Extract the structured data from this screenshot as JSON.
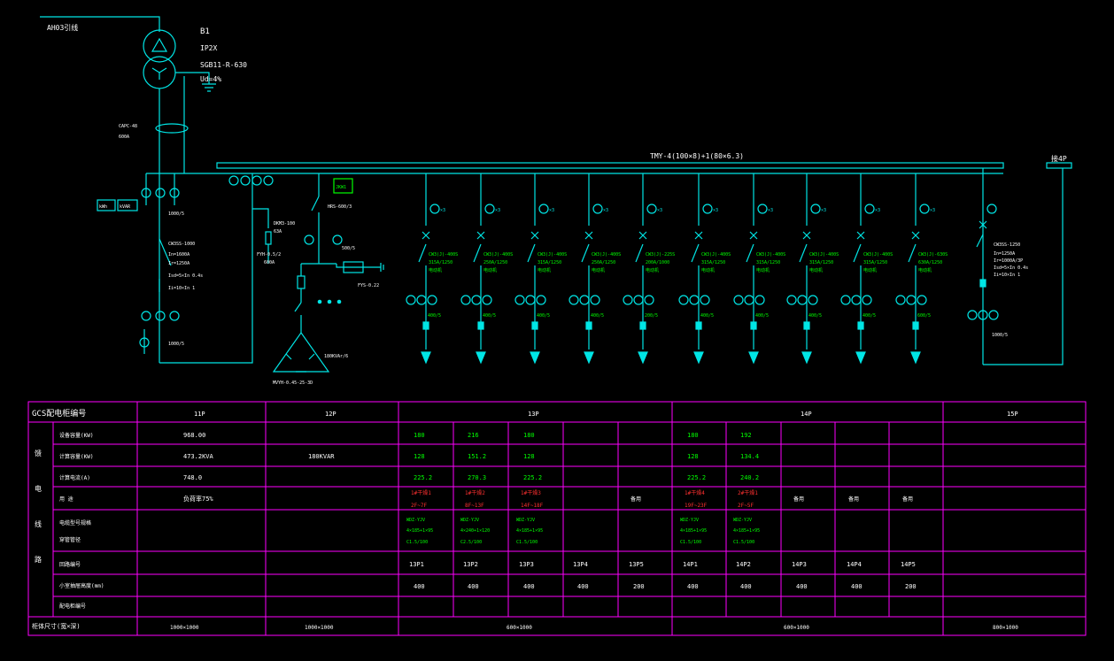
{
  "colors": {
    "background": "#000000",
    "wire": "#00e5e5",
    "grid": "#ff00ff",
    "text": "#ffffff",
    "value": "#00ff00",
    "alert": "#ff3030"
  },
  "diagram": {
    "incoming_label": "AH03引线",
    "transformer": {
      "name": "B1",
      "protection": "IP2X",
      "model": "SGB11-R-630",
      "impedance": "Ud=4%"
    },
    "busway_label": "CAPC-48",
    "busway_sub": "600A",
    "busbar_label": "TMY-4(100×8)+1(80×6.3)",
    "tie_label": "接4P",
    "meter_kwh": "kWh",
    "meter_kvar": "kVAR",
    "incomer": {
      "ct_top": "1000/5",
      "breaker": "CW3SS-1000",
      "b1": "In=1600A",
      "b2": "Ir=1250A",
      "b3": "Isd=5×In 0.4s",
      "b4": "Ii=10×In 1",
      "ct_bottom": "1000/5"
    },
    "capacitor": {
      "fuse": "DKM3-100",
      "fuse_sub": "63A",
      "arrester": "FYH-0.5/2",
      "arrester_sub": "600A",
      "switch": "HRS-600/3",
      "ct": "500/5",
      "reactor": "FYS-0.22",
      "bank": "180KVAr/6",
      "model": "MVYH-0.45-25-3D",
      "controller": "JKW1"
    },
    "tie_breaker": {
      "name": "CW3SS-1250",
      "l1": "In=1250A",
      "l2": "Ir=1000A/3P",
      "l3": "Isd=5×In 0.4s",
      "l4": "Ii=10×In 1",
      "ct": "1000/5"
    },
    "feeders": [
      {
        "amm": "×3",
        "brk": "CW3(J)-400S",
        "set": "315A/1250",
        "ctg": "400/5",
        "note": "电动机"
      },
      {
        "amm": "×3",
        "brk": "CW3(J)-400S",
        "set": "250A/1250",
        "ctg": "400/5",
        "note": "电动机"
      },
      {
        "amm": "×3",
        "brk": "CW3(J)-400S",
        "set": "315A/1250",
        "ctg": "400/5",
        "note": "电动机"
      },
      {
        "amm": "×3",
        "brk": "CW3(J)-400S",
        "set": "250A/1250",
        "ctg": "400/5",
        "note": "电动机"
      },
      {
        "amm": "×3",
        "brk": "CW3(J)-225S",
        "set": "200A/1000",
        "ctg": "200/5",
        "note": "电动机"
      },
      {
        "amm": "×3",
        "brk": "CW3(J)-400S",
        "set": "315A/1250",
        "ctg": "400/5",
        "note": "电动机"
      },
      {
        "amm": "×3",
        "brk": "CW3(J)-400S",
        "set": "315A/1250",
        "ctg": "400/5",
        "note": "电动机"
      },
      {
        "amm": "×3",
        "brk": "CW3(J)-400S",
        "set": "315A/1250",
        "ctg": "400/5",
        "note": "电动机"
      },
      {
        "amm": "×3",
        "brk": "CW3(J)-400S",
        "set": "315A/1250",
        "ctg": "400/5",
        "note": "电动机"
      },
      {
        "amm": "×3",
        "brk": "CW3(J)-630S",
        "set": "630A/1250",
        "ctg": "600/5",
        "note": "电动机"
      }
    ]
  },
  "table": {
    "header_label": "GCS配电柜编号",
    "panels": [
      "11P",
      "12P",
      "13P",
      "14P",
      "15P"
    ],
    "side_label": [
      "馈",
      "电",
      "线",
      "路"
    ],
    "row_labels": [
      "设备容量(KW)",
      "计算容量(KW)",
      "计算电流(A)",
      "用  途",
      "电缆型号规格",
      "穿管管径",
      "回路编号",
      "小室抽屉高度(mm)",
      "配电柜编号"
    ],
    "p11": {
      "capacity": "968.00",
      "calc": "473.2KVA",
      "current": "748.0",
      "use": "负荷率75%"
    },
    "p12": {
      "calc": "180KVAR"
    },
    "circuits": [
      {
        "cap": "180",
        "calc": "128",
        "cur": "225.2",
        "use1": "1#干燥1",
        "use2": "2F~7F",
        "cable": "WDZ-YJV",
        "cable2": "4×185+1×95",
        "pipe": "C1.5/100",
        "id": "13P1",
        "h": "400"
      },
      {
        "cap": "216",
        "calc": "151.2",
        "cur": "270.3",
        "use1": "1#干燥2",
        "use2": "8F~13F",
        "cable": "WDZ-YJV",
        "cable2": "4×240+1×120",
        "pipe": "C2.5/100",
        "id": "13P2",
        "h": "400"
      },
      {
        "cap": "180",
        "calc": "128",
        "cur": "225.2",
        "use1": "1#干燥3",
        "use2": "14F~18F",
        "cable": "WDZ-YJV",
        "cable2": "4×185+1×95",
        "pipe": "C1.5/100",
        "id": "13P3",
        "h": "400"
      },
      {
        "cap": "",
        "calc": "",
        "cur": "",
        "use1": "",
        "use2": "",
        "cable": "",
        "cable2": "",
        "pipe": "",
        "id": "13P4",
        "h": "400"
      },
      {
        "cap": "",
        "calc": "",
        "cur": "",
        "use1": "备用",
        "use2": "",
        "cable": "",
        "cable2": "",
        "pipe": "",
        "id": "13P5",
        "h": "200"
      },
      {
        "cap": "180",
        "calc": "128",
        "cur": "225.2",
        "use1": "1#干燥4",
        "use2": "19F~23F",
        "cable": "WDZ-YJV",
        "cable2": "4×185+1×95",
        "pipe": "C1.5/100",
        "id": "14P1",
        "h": "400"
      },
      {
        "cap": "192",
        "calc": "134.4",
        "cur": "240.2",
        "use1": "2#干燥1",
        "use2": "2F~5F",
        "cable": "WDZ-YJV",
        "cable2": "4×185+1×95",
        "pipe": "C1.5/100",
        "id": "14P2",
        "h": "400"
      },
      {
        "cap": "",
        "calc": "",
        "cur": "",
        "use1": "备用",
        "use2": "",
        "cable": "",
        "cable2": "",
        "pipe": "",
        "id": "14P3",
        "h": "400"
      },
      {
        "cap": "",
        "calc": "",
        "cur": "",
        "use1": "备用",
        "use2": "",
        "cable": "",
        "cable2": "",
        "pipe": "",
        "id": "14P4",
        "h": "400"
      },
      {
        "cap": "",
        "calc": "",
        "cur": "",
        "use1": "备用",
        "use2": "",
        "cable": "",
        "cable2": "",
        "pipe": "",
        "id": "14P5",
        "h": "200"
      }
    ],
    "footer_label": "柜体尺寸(宽×深)",
    "dims": [
      "1000×1000",
      "1000×1000",
      "600×1000",
      "600×1000",
      "800×1000"
    ]
  }
}
